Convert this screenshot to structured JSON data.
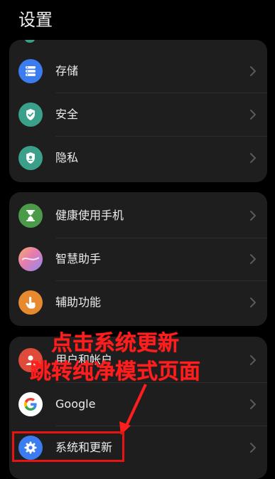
{
  "header": {
    "title": "设置"
  },
  "groups": [
    {
      "items": [
        {
          "label": "存储",
          "icon": "storage-icon",
          "color": "#3b7cf0"
        },
        {
          "label": "安全",
          "icon": "security-shield-icon",
          "color": "#3aa08a"
        },
        {
          "label": "隐私",
          "icon": "privacy-icon",
          "color": "#3aa08a"
        }
      ]
    },
    {
      "items": [
        {
          "label": "健康使用手机",
          "icon": "hourglass-icon",
          "color": "#4a9a49"
        },
        {
          "label": "智慧助手",
          "icon": "assistant-icon",
          "color": "#b48ad8"
        },
        {
          "label": "辅助功能",
          "icon": "accessibility-hand-icon",
          "color": "#e7892e"
        }
      ]
    },
    {
      "items": [
        {
          "label": "用户和帐户",
          "icon": "user-account-icon",
          "color": "#e04a3a"
        },
        {
          "label": "Google",
          "icon": "google-icon",
          "color": "#ffffff"
        },
        {
          "label": "系统和更新",
          "icon": "system-gear-icon",
          "color": "#3b7cf0"
        }
      ]
    }
  ],
  "annotation": {
    "line1": "点击系统更新",
    "line2": "跳转纯净模式页面",
    "color": "#ff1d1d"
  }
}
